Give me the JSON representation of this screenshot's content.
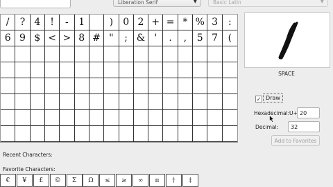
{
  "toolbar": {
    "search_value": "",
    "font_select": "Liberation Serif",
    "block_select": "Basic Latin"
  },
  "grid": {
    "rows": 8,
    "cols": 16,
    "row1": [
      "/",
      "?",
      "4",
      "!",
      "-",
      "1",
      "",
      ")",
      "0",
      "2",
      "+",
      "=",
      "*",
      "%",
      "3",
      ":"
    ],
    "row2": [
      "6",
      "9",
      "$",
      "<",
      ">",
      "8",
      "#",
      "\"",
      ";",
      "&",
      "'",
      ".",
      ",",
      "5",
      "7",
      "("
    ]
  },
  "preview": {
    "char_name": "SPACE"
  },
  "controls": {
    "draw_label": "Draw",
    "draw_checked": true,
    "hex_label": "Hexadecimal:",
    "hex_prefix": "U+",
    "hex_value": "20",
    "dec_label": "Decimal:",
    "dec_value": "32",
    "add_favorites_label": "Add to Favorites"
  },
  "recent": {
    "label": "Recent Characters:"
  },
  "favorites": {
    "label": "Favorite Characters:",
    "items": [
      "€",
      "¥",
      "£",
      "©",
      "Σ",
      "Ω",
      "≤",
      "≥",
      "∞",
      "π",
      "†",
      "‡"
    ]
  }
}
